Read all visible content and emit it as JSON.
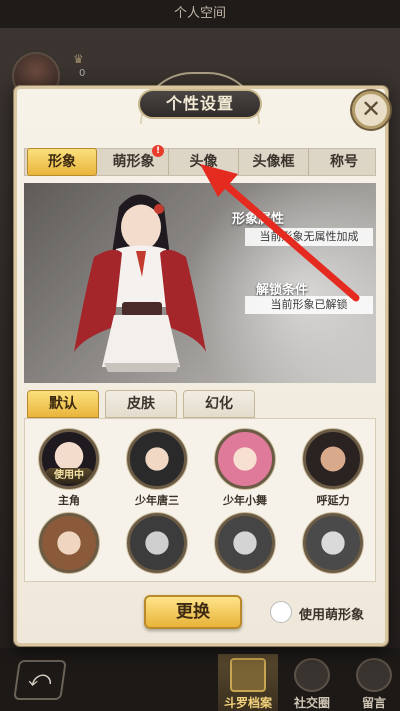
{
  "screen_title": "个人空间",
  "background": {
    "counter": "0"
  },
  "modal": {
    "title": "个性设置",
    "close_label": "✕",
    "tabs": [
      {
        "label": "形象",
        "active": true
      },
      {
        "label": "萌形象",
        "badge": "!"
      },
      {
        "label": "头像"
      },
      {
        "label": "头像框"
      },
      {
        "label": "称号"
      }
    ],
    "preview": {
      "attr_title": "形象属性",
      "attr_value": "当前形象无属性加成",
      "unlock_title": "解锁条件",
      "unlock_value": "当前形象已解锁"
    },
    "subtabs": [
      {
        "label": "默认",
        "active": true
      },
      {
        "label": "皮肤"
      },
      {
        "label": "幻化"
      }
    ],
    "characters": [
      {
        "name": "主角",
        "in_use": "使用中"
      },
      {
        "name": "少年唐三"
      },
      {
        "name": "少年小舞"
      },
      {
        "name": "呼延力"
      },
      {
        "name": ""
      },
      {
        "name": ""
      },
      {
        "name": ""
      },
      {
        "name": ""
      }
    ],
    "change_button": "更换",
    "use_moe_label": "使用萌形象"
  },
  "bottom_nav": {
    "back": "⤺",
    "tabs": [
      {
        "label": "斗罗档案",
        "active": true
      },
      {
        "label": "社交圈"
      },
      {
        "label": "留言"
      }
    ]
  },
  "colors": {
    "accent_gold": "#e9b53c",
    "arrow_red": "#e52a1f",
    "panel_bg": "#f7f2e8"
  }
}
